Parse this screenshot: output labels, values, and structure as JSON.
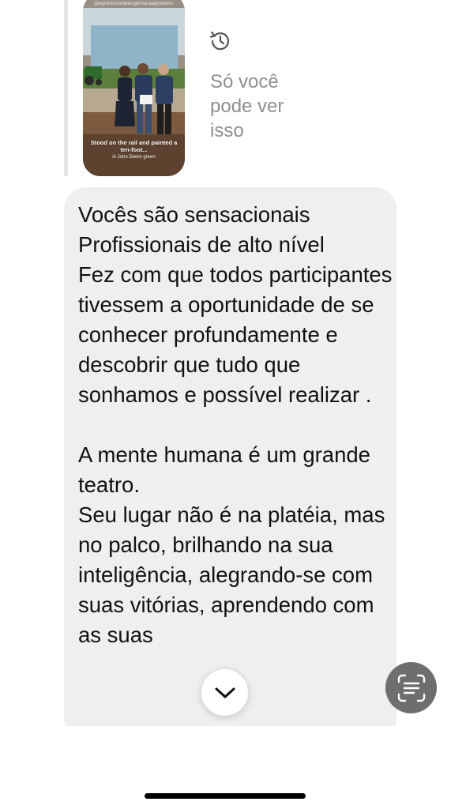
{
  "story_reply": {
    "handle": "@agrohorizonteengenhariaagronomo",
    "caption": "Stood on the rail and painted a ten-foot...",
    "subcaption": "in John Deere green",
    "view_once_label": "Só você pode ver isso",
    "view_once_icon": "clock-rewind-icon"
  },
  "message": {
    "text": "Vocês são sensacionais\nProfissionais de alto nível\nFez com que todos participantes tivessem a oportunidade de se conhecer profundamente e descobrir que tudo que sonhamos e possível realizar .\n\nA mente humana é um grande teatro.\nSeu lugar não é na platéia, mas no palco, brilhando na sua inteligência, alegrando-se com suas vitórias, aprendendo com as suas"
  },
  "controls": {
    "scroll_down_icon": "chevron-down-icon",
    "live_text_icon": "text-scan-icon"
  },
  "colors": {
    "bubble": "#efefef",
    "muted_text": "#8e8e93",
    "live_text_button": "#6e6e6e"
  }
}
